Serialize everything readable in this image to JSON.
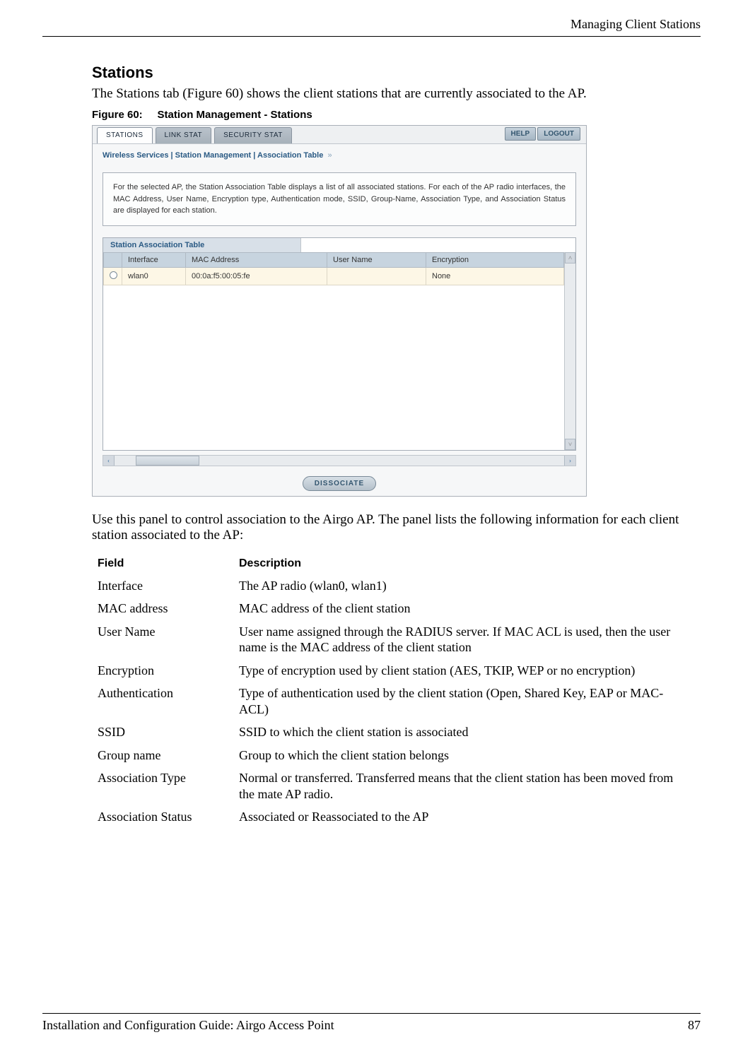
{
  "header": {
    "title": "Managing Client Stations"
  },
  "section": {
    "title": "Stations",
    "intro": "The Stations tab (Figure 60) shows the client stations that are currently associated to the AP.",
    "figure_caption_label": "Figure 60:",
    "figure_caption_text": "Station Management - Stations"
  },
  "screenshot": {
    "tabs": {
      "stations": "STATIONS",
      "linkstat": "LINK STAT",
      "secstat": "SECURITY STAT"
    },
    "buttons": {
      "help": "HELP",
      "logout": "LOGOUT",
      "dissociate": "DISSOCIATE"
    },
    "breadcrumb": "Wireless Services | Station Management | Association Table",
    "description": "For the selected AP, the Station Association Table displays a list of all associated stations. For each of the AP radio interfaces, the MAC Address, User Name, Encryption type, Authentication mode, SSID, Group-Name, Association Type, and Association Status are displayed for each station.",
    "table_title": "Station Association Table",
    "columns": {
      "interface": "Interface",
      "mac": "MAC Address",
      "user": "User Name",
      "enc": "Encryption"
    },
    "rows": [
      {
        "interface": "wlan0",
        "mac": "00:0a:f5:00:05:fe",
        "user": "",
        "enc": "None"
      }
    ]
  },
  "after": {
    "text": "Use this panel to control association to the Airgo AP. The panel lists the following information for each client station associated to the AP:"
  },
  "field_table": {
    "head_field": "Field",
    "head_desc": "Description",
    "rows": [
      {
        "f": "Interface",
        "d": "The AP radio (wlan0, wlan1)"
      },
      {
        "f": "MAC address",
        "d": "MAC address of the client station"
      },
      {
        "f": "User Name",
        "d": "User name assigned through the RADIUS server. If MAC ACL is used, then the user name is the MAC address of the client station"
      },
      {
        "f": "Encryption",
        "d": "Type of encryption used by client station (AES, TKIP, WEP or no encryption)"
      },
      {
        "f": "Authentication",
        "d": "Type of authentication used by the client station (Open, Shared Key, EAP or MAC-ACL)"
      },
      {
        "f": "SSID",
        "d": "SSID to which the client station is associated"
      },
      {
        "f": "Group name",
        "d": "Group to which the client station belongs"
      },
      {
        "f": "Association Type",
        "d": "Normal or transferred. Transferred means that the client station has been moved from the mate AP radio."
      },
      {
        "f": "Association Status",
        "d": "Associated or Reassociated to the AP"
      }
    ]
  },
  "footer": {
    "left": "Installation and Configuration Guide: Airgo Access Point",
    "right": "87"
  }
}
